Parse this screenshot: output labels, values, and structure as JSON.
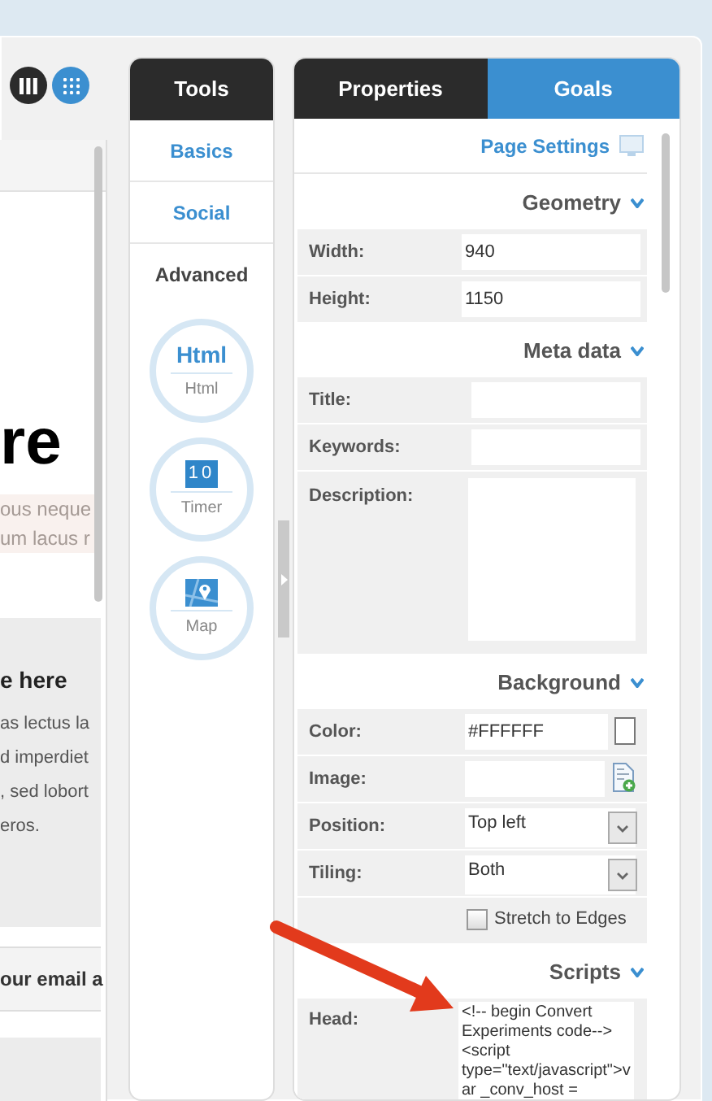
{
  "view_toggle": [
    {
      "selected": true
    },
    {
      "selected": false
    }
  ],
  "canvas": {
    "heading": "re",
    "intro_lines": [
      "ous neque",
      "um lacus r"
    ],
    "box_title": "e here",
    "box_lines": [
      "as lectus la",
      "d imperdiet",
      ", sed lobort",
      "eros."
    ],
    "email_label": "our email a"
  },
  "tools": {
    "tab": "Tools",
    "items": [
      {
        "label": "Basics",
        "selected": false
      },
      {
        "label": "Social",
        "selected": false
      },
      {
        "label": "Advanced",
        "selected": true
      }
    ],
    "widgets": [
      {
        "kind": "html",
        "glyph": "Html",
        "label": "Html"
      },
      {
        "kind": "timer",
        "glyph": "10",
        "label": "Timer"
      },
      {
        "kind": "map",
        "label": "Map"
      }
    ]
  },
  "properties": {
    "tabs": [
      {
        "label": "Properties",
        "selected": true
      },
      {
        "label": "Goals",
        "selected": false
      }
    ],
    "page_settings": "Page Settings",
    "sections": [
      {
        "title": "Geometry",
        "expanded": true,
        "rows": [
          {
            "kind": "text",
            "label": "Width:",
            "value": "940"
          },
          {
            "kind": "text",
            "label": "Height:",
            "value": "1150"
          }
        ]
      },
      {
        "title": "Meta data",
        "expanded": true,
        "rows": [
          {
            "kind": "text",
            "label": "Title:"
          },
          {
            "kind": "text",
            "label": "Keywords:"
          },
          {
            "kind": "textarea",
            "label": "Description:"
          }
        ]
      },
      {
        "title": "Background",
        "expanded": true,
        "rows": [
          {
            "kind": "color",
            "label": "Color:",
            "value": "#FFFFFF",
            "color": "#ffffff"
          },
          {
            "kind": "file",
            "label": "Image:"
          },
          {
            "kind": "select",
            "label": "Position:",
            "value": "Top left"
          },
          {
            "kind": "select",
            "label": "Tiling:",
            "value": "Both"
          },
          {
            "kind": "checkbox",
            "label": "Stretch to Edges",
            "checked": false
          }
        ]
      },
      {
        "title": "Scripts",
        "expanded": true,
        "rows": [
          {
            "kind": "code",
            "label": "Head:",
            "value": "<!-- begin Convert Experiments code--><script type=\"text/javascript\">var _conv_host ="
          }
        ]
      }
    ]
  }
}
